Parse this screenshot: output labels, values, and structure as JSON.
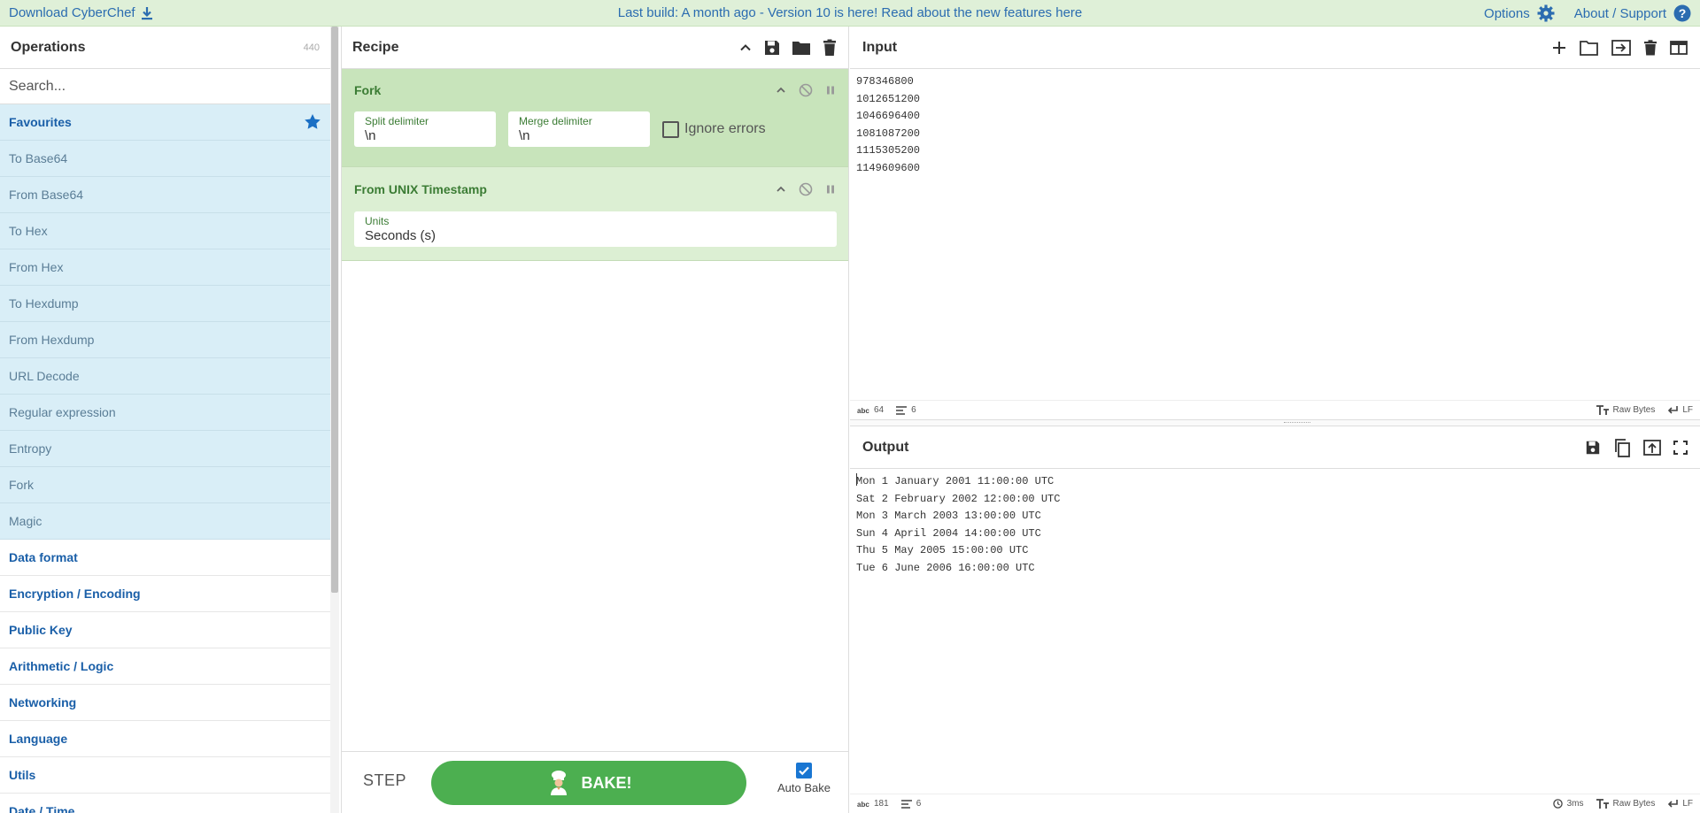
{
  "banner": {
    "download_label": "Download CyberChef",
    "message": "Last build: A month ago - Version 10 is here! Read about the new features here",
    "options_label": "Options",
    "about_label": "About / Support"
  },
  "operations": {
    "title": "Operations",
    "count": "440",
    "search_placeholder": "Search...",
    "favourites_label": "Favourites",
    "favourites": [
      "To Base64",
      "From Base64",
      "To Hex",
      "From Hex",
      "To Hexdump",
      "From Hexdump",
      "URL Decode",
      "Regular expression",
      "Entropy",
      "Fork",
      "Magic"
    ],
    "categories": [
      "Data format",
      "Encryption / Encoding",
      "Public Key",
      "Arithmetic / Logic",
      "Networking",
      "Language",
      "Utils",
      "Date / Time"
    ]
  },
  "recipe": {
    "title": "Recipe",
    "operations": [
      {
        "name": "Fork",
        "split_label": "Split delimiter",
        "split_value": "\\n",
        "merge_label": "Merge delimiter",
        "merge_value": "\\n",
        "ignore_errors_label": "Ignore errors",
        "ignore_errors_checked": false
      },
      {
        "name": "From UNIX Timestamp",
        "units_label": "Units",
        "units_value": "Seconds (s)"
      }
    ],
    "step_label": "STEP",
    "bake_label": "BAKE!",
    "auto_bake_label": "Auto Bake",
    "auto_bake_checked": true
  },
  "input": {
    "title": "Input",
    "text": "978346800\n1012651200\n1046696400\n1081087200\n1115305200\n1149609600",
    "char_count": "64",
    "line_count": "6",
    "encoding": "Raw Bytes",
    "eol": "LF"
  },
  "output": {
    "title": "Output",
    "text": "Mon 1 January 2001 11:00:00 UTC\nSat 2 February 2002 12:00:00 UTC\nMon 3 March 2003 13:00:00 UTC\nSun 4 April 2004 14:00:00 UTC\nThu 5 May 2005 15:00:00 UTC\nTue 6 June 2006 16:00:00 UTC",
    "char_count": "181",
    "line_count": "6",
    "bake_time": "3ms",
    "encoding": "Raw Bytes",
    "eol": "LF"
  },
  "colors": {
    "banner_bg": "#dff0d8",
    "link": "#2b6cb0",
    "favourites_bg": "#d9eef7",
    "fork_bg": "#c8e4bb",
    "unix_bg": "#dcefd3",
    "bake_green": "#4caf50",
    "checkbox_blue": "#1976d2"
  }
}
